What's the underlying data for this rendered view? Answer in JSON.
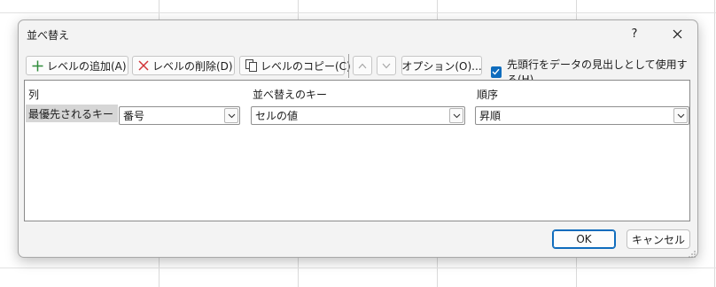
{
  "dialog": {
    "title": "並べ替え",
    "help_label": "?"
  },
  "toolbar": {
    "add_level": "レベルの追加(A)",
    "delete_level": "レベルの削除(D)",
    "copy_level": "レベルのコピー(C)",
    "options": "オプション(O)...",
    "header_checkbox_label": "先頭行をデータの見出しとして使用する(H)",
    "header_checkbox_checked": true
  },
  "columns": {
    "column": "列",
    "sort_on": "並べ替えのキー",
    "order": "順序"
  },
  "rows": [
    {
      "label": "最優先されるキー",
      "column": "番号",
      "sort_on": "セルの値",
      "order": "昇順"
    }
  ],
  "footer": {
    "ok": "OK",
    "cancel": "キャンセル"
  },
  "colors": {
    "accent": "#0f6cbd",
    "add_icon": "#2e8b3a",
    "delete_icon": "#d13438"
  },
  "icons": [
    "plus-icon",
    "delete-x-icon",
    "copy-icon",
    "arrow-up-icon",
    "arrow-down-icon",
    "checkmark-icon",
    "chevron-down-icon",
    "close-icon"
  ]
}
